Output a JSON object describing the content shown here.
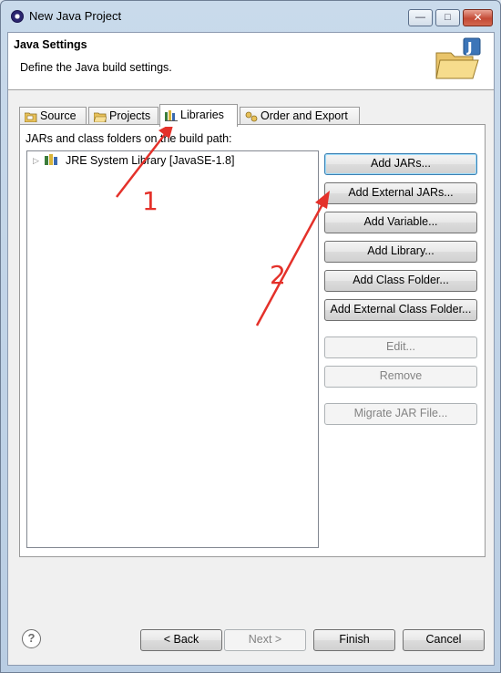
{
  "window": {
    "title": "New Java Project"
  },
  "header": {
    "title": "Java Settings",
    "description": "Define the Java build settings."
  },
  "tabs": [
    {
      "label": "Source",
      "icon": "source-folder-icon"
    },
    {
      "label": "Projects",
      "icon": "projects-folder-icon"
    },
    {
      "label": "Libraries",
      "icon": "libraries-icon",
      "active": true
    },
    {
      "label": "Order and Export",
      "icon": "order-export-icon"
    }
  ],
  "panel": {
    "label": "JARs and class folders on the build path:",
    "tree": [
      {
        "label": "JRE System Library [JavaSE-1.8]",
        "expanded": false
      }
    ]
  },
  "buttons": {
    "add_jars": "Add JARs...",
    "add_external_jars": "Add External JARs...",
    "add_variable": "Add Variable...",
    "add_library": "Add Library...",
    "add_class_folder": "Add Class Folder...",
    "add_external_class_folder": "Add External Class Folder...",
    "edit": "Edit...",
    "remove": "Remove",
    "migrate": "Migrate JAR File..."
  },
  "footer": {
    "back": "< Back",
    "next": "Next >",
    "finish": "Finish",
    "cancel": "Cancel"
  },
  "annotations": {
    "label_1": "1",
    "label_2": "2",
    "color": "#e4312a"
  }
}
